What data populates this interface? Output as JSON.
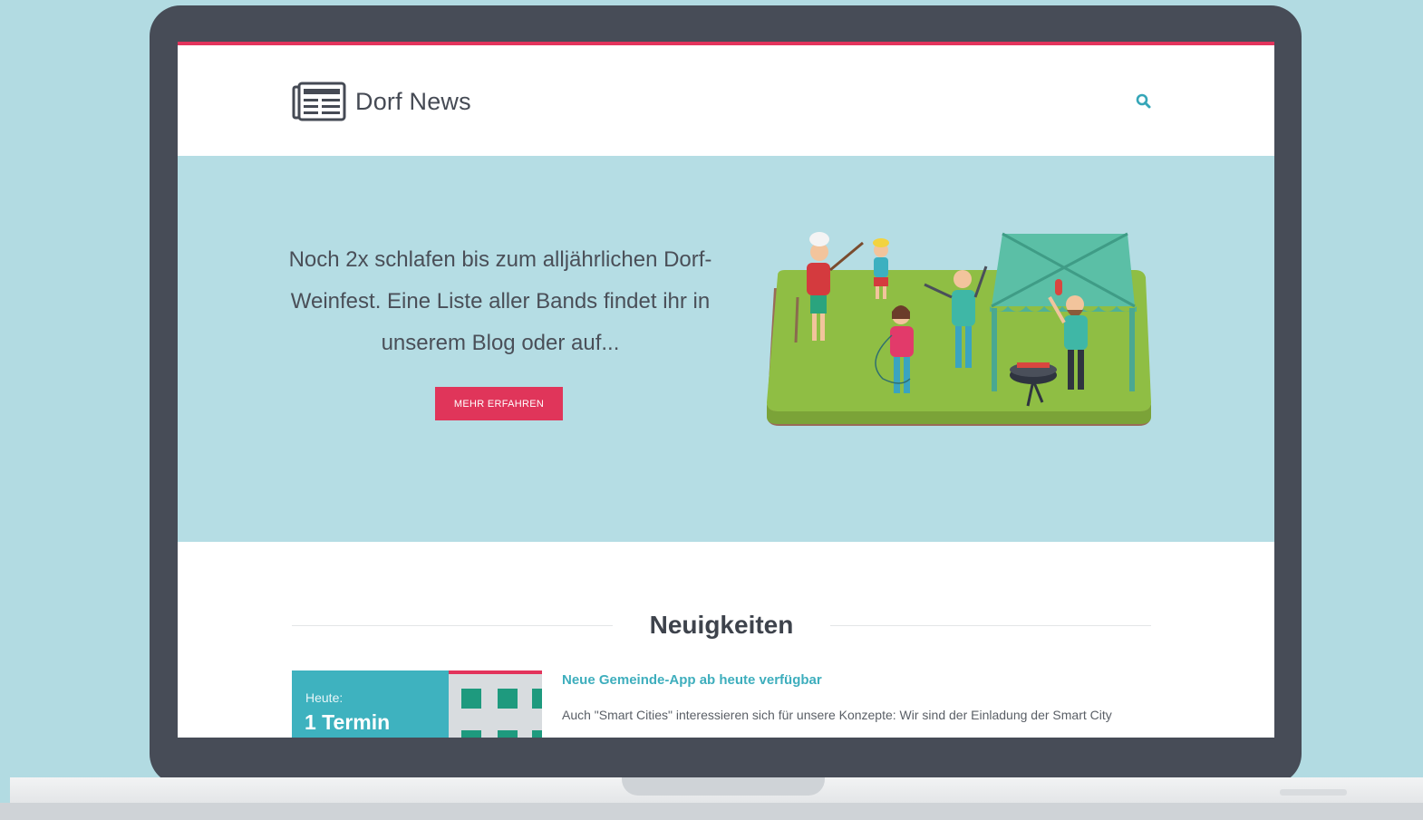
{
  "site": {
    "name": "Dorf News",
    "accent_color": "#e3345c",
    "header_icons": [
      "newspaper-icon",
      "search-icon"
    ]
  },
  "hero": {
    "text": "Noch 2x schlafen bis zum alljährlichen Dorf-Weinfest. Eine Liste aller Bands findet ihr in unserem Blog oder auf...",
    "cta_label": "MEHR ERFAHREN",
    "cta_color": "#e0355a",
    "illustration": "village-festival-illustration"
  },
  "news": {
    "heading": "Neuigkeiten",
    "event": {
      "label": "Heute:",
      "count": "1 Termin"
    },
    "article": {
      "title": "Neue Gemeinde-App ab heute verfügbar",
      "excerpt": "Auch \"Smart Cities\" interessieren sich für unsere Konzepte: Wir sind der Einladung der Smart City"
    }
  }
}
